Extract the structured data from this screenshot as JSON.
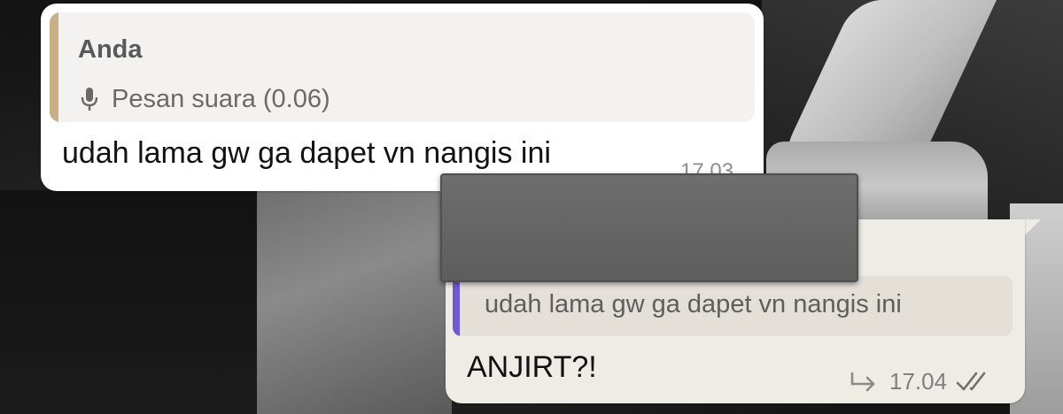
{
  "incoming": {
    "quote": {
      "sender": "Anda",
      "preview": "Pesan suara (0.06)",
      "icon": "microphone-icon",
      "accent_color": "#c9ae86"
    },
    "text": "udah lama gw ga dapet vn nangis ini",
    "time": "17.03"
  },
  "outgoing": {
    "quote": {
      "text": "udah lama gw ga dapet vn nangis ini",
      "accent_color": "#7057d8"
    },
    "text": "ANJIRT?!",
    "time": "17.04",
    "icons": [
      "forward-icon",
      "double-check-icon"
    ]
  },
  "colors": {
    "incoming_bubble": "#ffffff",
    "outgoing_bubble": "#efebe5",
    "redaction": "#656565"
  }
}
